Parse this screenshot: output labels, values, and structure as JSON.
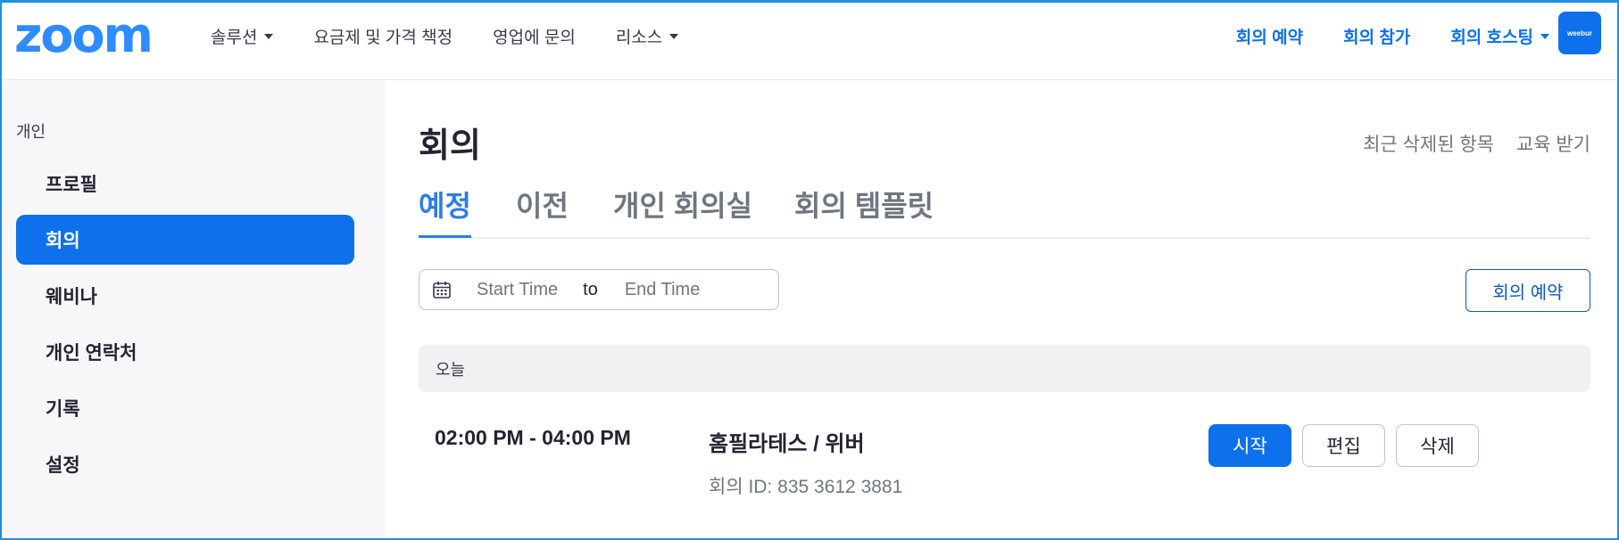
{
  "header": {
    "logo": "zoom",
    "nav_left": [
      {
        "label": "솔루션",
        "caret": true
      },
      {
        "label": "요금제 및 가격 책정",
        "caret": false
      },
      {
        "label": "영업에 문의",
        "caret": false
      },
      {
        "label": "리소스",
        "caret": true
      }
    ],
    "nav_right": [
      {
        "label": "회의 예약",
        "caret": false
      },
      {
        "label": "회의 참가",
        "caret": false
      },
      {
        "label": "회의 호스팅",
        "caret": true
      }
    ],
    "avatar_text": "weebur"
  },
  "sidebar": {
    "section_label": "개인",
    "items": [
      {
        "label": "프로필",
        "active": false
      },
      {
        "label": "회의",
        "active": true
      },
      {
        "label": "웨비나",
        "active": false
      },
      {
        "label": "개인 연락처",
        "active": false
      },
      {
        "label": "기록",
        "active": false
      },
      {
        "label": "설정",
        "active": false
      }
    ]
  },
  "main": {
    "title": "회의",
    "links": {
      "recently_deleted": "최근 삭제된 항목",
      "get_training": "교육 받기"
    },
    "tabs": [
      "예정",
      "이전",
      "개인 회의실",
      "회의 템플릿"
    ],
    "active_tab": "예정",
    "date_range": {
      "start_placeholder": "Start Time",
      "separator": "to",
      "end_placeholder": "End Time"
    },
    "schedule_button": "회의 예약",
    "day_label": "오늘",
    "meeting": {
      "time": "02:00 PM - 04:00 PM",
      "title": "홈필라테스 / 위버",
      "meeting_id": "회의 ID: 835 3612 3881",
      "actions": {
        "start": "시작",
        "edit": "편집",
        "delete": "삭제"
      }
    }
  },
  "colors": {
    "accent": "#0e71eb",
    "logo": "#2d8cff",
    "active_tab": "#2d7de3",
    "frame": "#1f8fe0"
  }
}
